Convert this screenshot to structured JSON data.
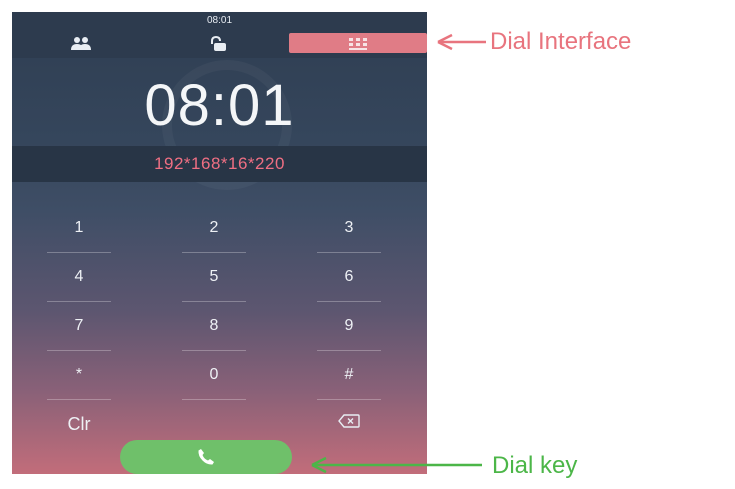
{
  "status": {
    "time": "08:01"
  },
  "top_tabs": [
    {
      "name": "contacts-tab",
      "icon": "contacts-icon"
    },
    {
      "name": "unlock-tab",
      "icon": "unlock-icon"
    },
    {
      "name": "dialpad-tab",
      "icon": "dialpad-grid-icon",
      "active": true,
      "color": "#e07c86"
    }
  ],
  "clock": "08:01",
  "dialed_number": "192*168*16*220",
  "keypad": {
    "row1": [
      "1",
      "2",
      "3"
    ],
    "row2": [
      "4",
      "5",
      "6"
    ],
    "row3": [
      "7",
      "8",
      "9"
    ],
    "row4": [
      "*",
      "0",
      "#"
    ],
    "clear": "Clr",
    "backspace_icon": "backspace-icon"
  },
  "call_button": {
    "icon": "phone-icon",
    "color": "#6fc06a"
  },
  "annotations": {
    "dial_interface": {
      "text": "Dial Interface",
      "color": "#e8747e"
    },
    "dial_key": {
      "text": "Dial key",
      "color": "#4cb648"
    }
  }
}
